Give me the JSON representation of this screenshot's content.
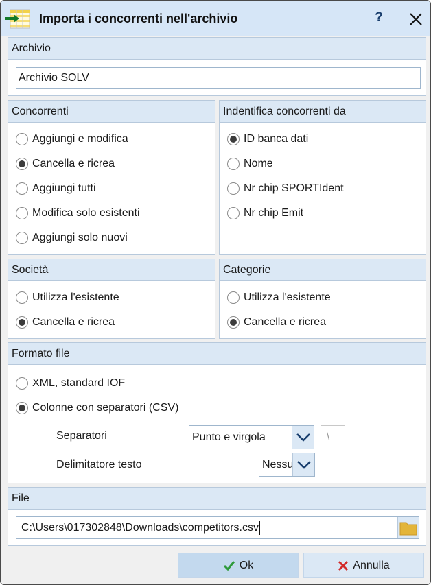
{
  "window": {
    "title": "Importa i concorrenti nell'archivio",
    "help_label": "?"
  },
  "archive": {
    "header": "Archivio",
    "value": "Archivio SOLV"
  },
  "competitors": {
    "header": "Concorrenti",
    "options": [
      {
        "label": "Aggiungi e modifica",
        "checked": false
      },
      {
        "label": "Cancella e ricrea",
        "checked": true
      },
      {
        "label": "Aggiungi tutti",
        "checked": false
      },
      {
        "label": "Modifica solo esistenti",
        "checked": false
      },
      {
        "label": "Aggiungi solo nuovi",
        "checked": false
      }
    ]
  },
  "identify": {
    "header": "Indentifica concorrenti da",
    "options": [
      {
        "label": "ID banca dati",
        "checked": true
      },
      {
        "label": "Nome",
        "checked": false
      },
      {
        "label": "Nr chip SPORTIdent",
        "checked": false
      },
      {
        "label": "Nr chip Emit",
        "checked": false
      }
    ]
  },
  "clubs": {
    "header": "Società",
    "options": [
      {
        "label": "Utilizza l'esistente",
        "checked": false
      },
      {
        "label": "Cancella e ricrea",
        "checked": true
      }
    ]
  },
  "categories": {
    "header": "Categorie",
    "options": [
      {
        "label": "Utilizza l'esistente",
        "checked": false
      },
      {
        "label": "Cancella e ricrea",
        "checked": true
      }
    ]
  },
  "format": {
    "header": "Formato file",
    "options": [
      {
        "label": "XML, standard IOF",
        "checked": false
      },
      {
        "label": "Colonne con separatori (CSV)",
        "checked": true
      }
    ],
    "separators_label": "Separatori",
    "separators_value": "Punto e virgola",
    "separator_char": "\\",
    "delimiter_label": "Delimitatore testo",
    "delimiter_value": "Nessu"
  },
  "file": {
    "header": "File",
    "path": "C:\\Users\\017302848\\Downloads\\competitors.csv"
  },
  "buttons": {
    "ok": "Ok",
    "cancel": "Annulla"
  },
  "colors": {
    "titlebar": "#d6e6f7",
    "group_header": "#dbe8f5",
    "ok_check": "#2e9a3a",
    "cancel_x": "#d22a2a",
    "folder": "#e3b53a"
  }
}
